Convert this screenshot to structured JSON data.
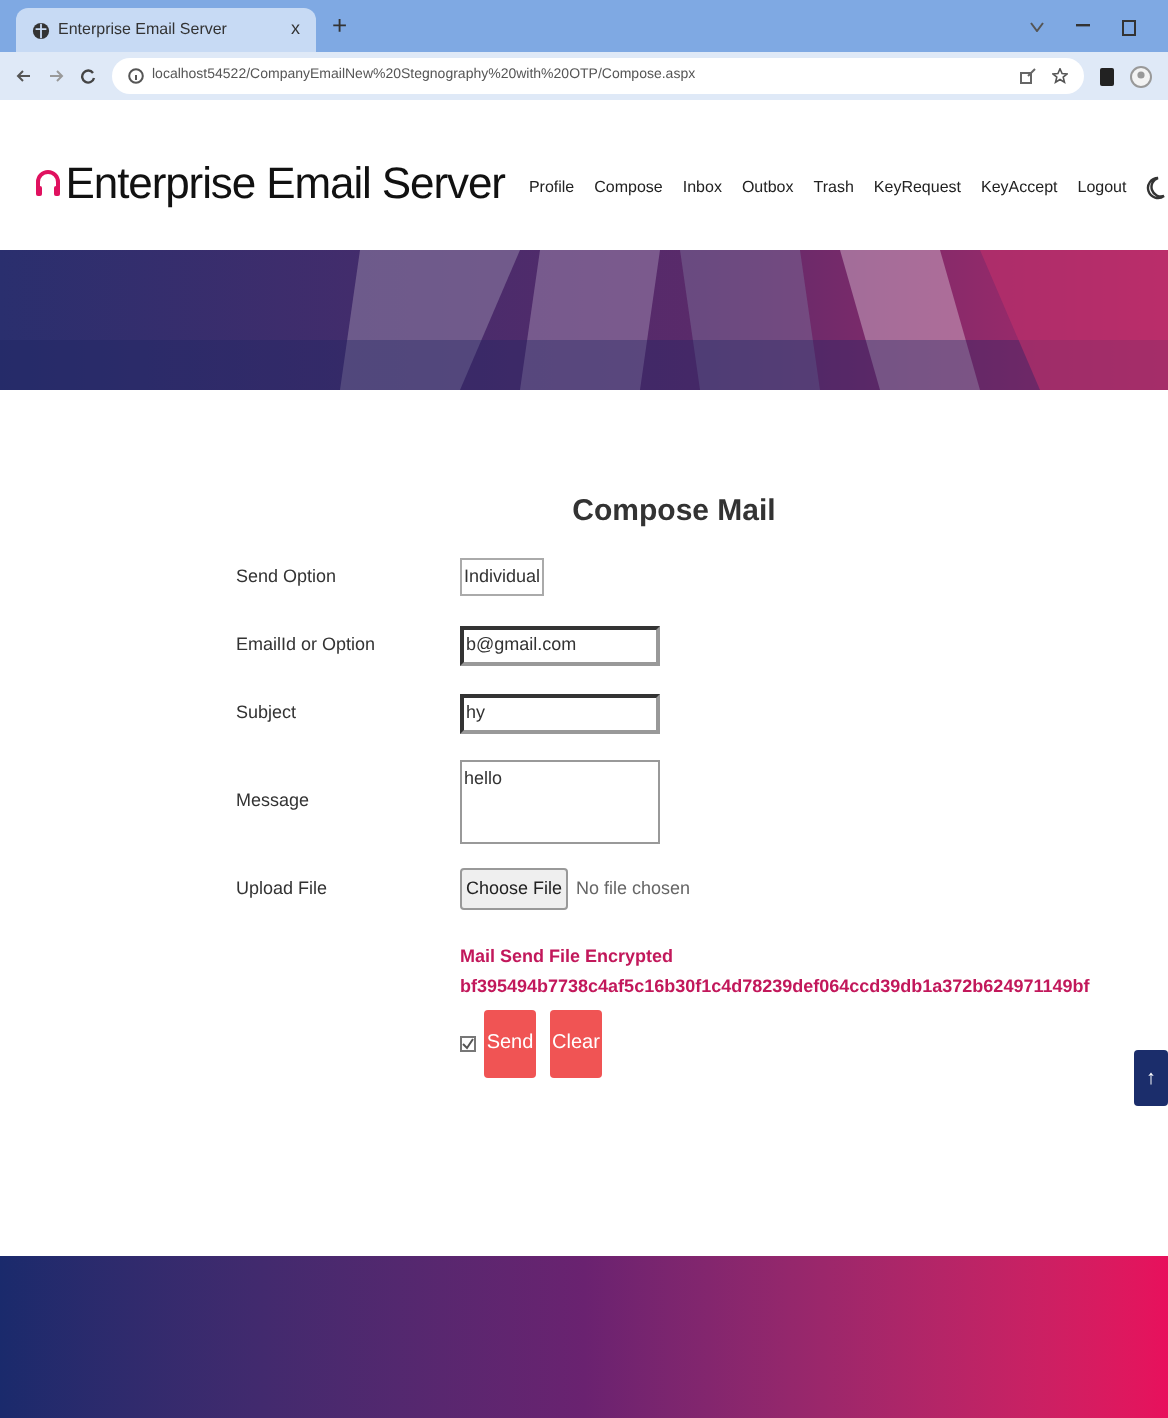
{
  "browser": {
    "tab_title": "Enterprise Email Server",
    "tab_close": "x",
    "new_tab": "+",
    "url": "localhost54522/CompanyEmailNew%20Stegnography%20with%20OTP/Compose.aspx"
  },
  "header": {
    "brand": "Enterprise Email Server",
    "nav": [
      {
        "label": "Profile"
      },
      {
        "label": "Compose"
      },
      {
        "label": "Inbox"
      },
      {
        "label": "Outbox"
      },
      {
        "label": "Trash"
      },
      {
        "label": "KeyRequest"
      },
      {
        "label": "KeyAccept"
      },
      {
        "label": "Logout"
      }
    ]
  },
  "form": {
    "title": "Compose Mail",
    "fields": [
      {
        "label": "Send Option",
        "kind": "select",
        "value": "Individual"
      },
      {
        "label": "EmailId or Option",
        "kind": "text",
        "value": "b@gmail.com"
      },
      {
        "label": "Subject",
        "kind": "text",
        "value": "hy"
      },
      {
        "label": "Message",
        "kind": "textarea",
        "value": "hello"
      },
      {
        "label": "Upload File",
        "kind": "file",
        "button": "Choose File",
        "value": "No file chosen"
      }
    ],
    "status": "Mail Send File Encrypted",
    "hash": "bf395494b7738c4af5c16b30f1c4d78239def064ccd39db1a372b624971149bf",
    "checkbox": {
      "checked": true
    },
    "buttons": [
      "Send",
      "Clear"
    ]
  },
  "scroll_top": {
    "label": "↑"
  }
}
